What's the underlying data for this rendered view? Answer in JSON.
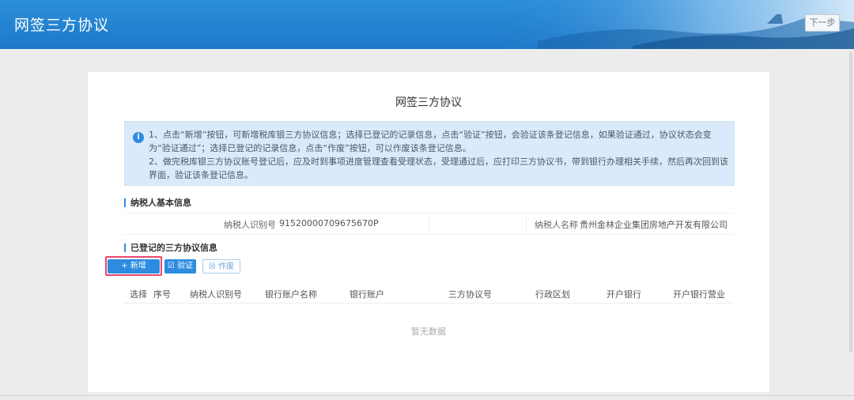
{
  "header": {
    "title": "网签三方协议",
    "next_label": "下一步"
  },
  "card": {
    "title": "网签三方协议"
  },
  "notice": {
    "line1": "1、点击“新增”按钮，可新增税库银三方协议信息；选择已登记的记录信息，点击“验证”按钮，会验证该条登记信息，如果验证通过，协议状态会变为“验证通过”；选择已登记的记录信息，点击“作废”按钮，可以作废该条登记信息。",
    "line2": "2、做完税库银三方协议账号登记后，应及时到事项进度管理查看受理状态，受理通过后，应打印三方协议书，带到银行办理相关手续，然后再次回到该界面，验证该条登记信息。"
  },
  "taxpayer": {
    "section_title": "纳税人基本信息",
    "id_label": "纳税人识别号",
    "id_value": "91520000709675670P",
    "name_label": "纳税人名称",
    "name_value": "贵州金林企业集团房地产开发有限公司"
  },
  "agreements": {
    "section_title": "已登记的三方协议信息",
    "add_label": "+ 新增",
    "verify_label": "☑ 验证",
    "void_label": "☒ 作废",
    "columns": [
      "选择",
      "序号",
      "纳税人识别号",
      "银行账户名称",
      "银行账户",
      "三方协议号",
      "行政区划",
      "开户银行",
      "开户银行营业"
    ],
    "empty_text": "暂无数据"
  },
  "colors": {
    "header_blue": "#1e79c9",
    "accent": "#2d8ce0",
    "highlight": "#e8476b"
  }
}
